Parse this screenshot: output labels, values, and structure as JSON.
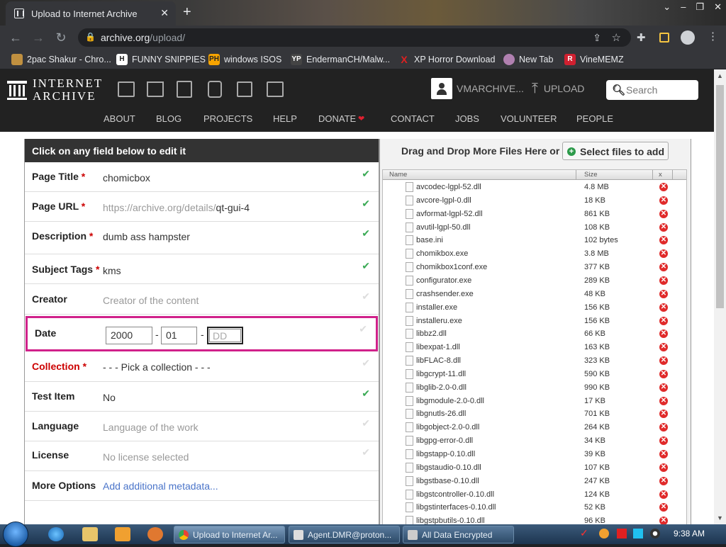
{
  "browser": {
    "tab_title": "Upload to Internet Archive",
    "tab_close": "✕",
    "new_tab": "+",
    "window_controls": [
      "⌄",
      "–",
      "❐",
      "✕"
    ],
    "url_host": "archive.org",
    "url_path": "/upload/",
    "bookmarks": [
      {
        "label": "2pac Shakur - Chro...",
        "icon": "2pac-icon",
        "icon_text": "",
        "icon_color": "#c09040"
      },
      {
        "label": "FUNNY SNIPPIES",
        "icon": "h-icon",
        "icon_text": "H",
        "icon_color": "#ffffff"
      },
      {
        "label": "windows ISOS",
        "icon": "ph-icon",
        "icon_text": "PH",
        "icon_color": "#f7a400"
      },
      {
        "label": "EndermanCH/Malw...",
        "icon": "yp-icon",
        "icon_text": "YP",
        "icon_color": "#444444"
      },
      {
        "label": "XP Horror Download",
        "icon": "x-icon",
        "icon_text": "X",
        "icon_color": "#e02020"
      },
      {
        "label": "New Tab",
        "icon": "newtab-icon",
        "icon_text": "",
        "icon_color": "#b080b0"
      },
      {
        "label": "VineMEMZ",
        "icon": "r-icon",
        "icon_text": "R",
        "icon_color": "#d02030"
      }
    ]
  },
  "ia": {
    "logo_line1": "INTERNET",
    "logo_line2": "ARCHIVE",
    "account_name": "VMARCHIVE...",
    "upload_label": "UPLOAD",
    "search_placeholder": "Search",
    "menu": [
      "ABOUT",
      "BLOG",
      "PROJECTS",
      "HELP",
      "DONATE",
      "CONTACT",
      "JOBS",
      "VOLUNTEER",
      "PEOPLE"
    ],
    "donate_heart": "❤"
  },
  "form": {
    "header": "Click on any field below to edit it",
    "fields": [
      {
        "label": "Page Title",
        "req": "*",
        "value": "chomicbox",
        "placeholder": false,
        "checked": true
      },
      {
        "label": "Page URL",
        "req": "*",
        "value_prefix": "https://archive.org/details/",
        "value": "qt-gui-4",
        "placeholder": false,
        "checked": true
      },
      {
        "label": "Description",
        "req": "*",
        "value": "dumb ass hampster",
        "placeholder": false,
        "checked": true
      },
      {
        "label": "Subject Tags",
        "req": "*",
        "value": "kms",
        "placeholder": false,
        "checked": true
      },
      {
        "label": "Creator",
        "req": "",
        "value": "Creator of the content",
        "placeholder": true,
        "checked": false
      },
      {
        "label": "Collection",
        "req": "*",
        "value": "- - - Pick a collection - - -",
        "placeholder": false,
        "checked": false
      },
      {
        "label": "Test Item",
        "req": "",
        "value": "No",
        "placeholder": false,
        "checked": true
      },
      {
        "label": "Language",
        "req": "",
        "value": "Language of the work",
        "placeholder": true,
        "checked": false
      },
      {
        "label": "License",
        "req": "",
        "value": "No license selected",
        "placeholder": true,
        "checked": false
      },
      {
        "label": "More Options",
        "req": "",
        "value": "Add additional metadata...",
        "placeholder": false,
        "checked": false
      }
    ],
    "date": {
      "label": "Date",
      "year": "2000",
      "month": "01",
      "day_placeholder": "DD",
      "sep": "-"
    },
    "check_glyph": "✔"
  },
  "files": {
    "drag_text": "Drag and Drop More Files Here or",
    "select_button": "Select files to add",
    "col_name": "Name",
    "col_size": "Size",
    "col_x": "x",
    "rows": [
      {
        "name": "avcodec-lgpl-52.dll",
        "size": "4.8 MB"
      },
      {
        "name": "avcore-lgpl-0.dll",
        "size": "18 KB"
      },
      {
        "name": "avformat-lgpl-52.dll",
        "size": "861 KB"
      },
      {
        "name": "avutil-lgpl-50.dll",
        "size": "108 KB"
      },
      {
        "name": "base.ini",
        "size": "102 bytes"
      },
      {
        "name": "chomikbox.exe",
        "size": "3.8 MB"
      },
      {
        "name": "chomikbox1conf.exe",
        "size": "377 KB"
      },
      {
        "name": "configurator.exe",
        "size": "289 KB"
      },
      {
        "name": "crashsender.exe",
        "size": "48 KB"
      },
      {
        "name": "installer.exe",
        "size": "156 KB"
      },
      {
        "name": "installeru.exe",
        "size": "156 KB"
      },
      {
        "name": "libbz2.dll",
        "size": "66 KB"
      },
      {
        "name": "libexpat-1.dll",
        "size": "163 KB"
      },
      {
        "name": "libFLAC-8.dll",
        "size": "323 KB"
      },
      {
        "name": "libgcrypt-11.dll",
        "size": "590 KB"
      },
      {
        "name": "libglib-2.0-0.dll",
        "size": "990 KB"
      },
      {
        "name": "libgmodule-2.0-0.dll",
        "size": "17 KB"
      },
      {
        "name": "libgnutls-26.dll",
        "size": "701 KB"
      },
      {
        "name": "libgobject-2.0-0.dll",
        "size": "264 KB"
      },
      {
        "name": "libgpg-error-0.dll",
        "size": "34 KB"
      },
      {
        "name": "libgstapp-0.10.dll",
        "size": "39 KB"
      },
      {
        "name": "libgstaudio-0.10.dll",
        "size": "107 KB"
      },
      {
        "name": "libgstbase-0.10.dll",
        "size": "247 KB"
      },
      {
        "name": "libgstcontroller-0.10.dll",
        "size": "124 KB"
      },
      {
        "name": "libgstinterfaces-0.10.dll",
        "size": "52 KB"
      },
      {
        "name": "libgstpbutils-0.10.dll",
        "size": "96 KB"
      }
    ]
  },
  "taskbar": {
    "tasks": [
      "Upload to Internet Ar...",
      "Agent.DMR@proton...",
      "All Data Encrypted"
    ],
    "clock": "9:38 AM"
  },
  "colors": {
    "ia_dark": "#222222",
    "required_red": "#cc0000",
    "focus_border": "#d0218a",
    "check_green": "#3aaa55"
  }
}
